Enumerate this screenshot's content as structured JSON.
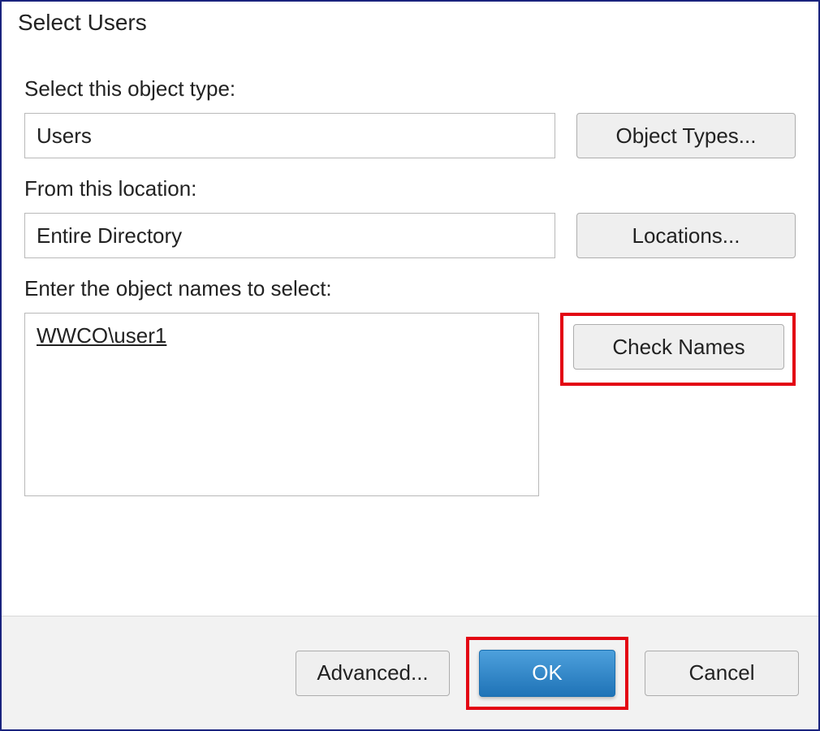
{
  "title": "Select Users",
  "labels": {
    "objectType": "Select this object type:",
    "location": "From this location:",
    "names": "Enter the object names to select:"
  },
  "fields": {
    "objectTypeValue": "Users",
    "locationValue": "Entire Directory",
    "namesValue": "WWCO\\user1"
  },
  "buttons": {
    "objectTypes": "Object Types...",
    "locations": "Locations...",
    "checkNames": "Check Names",
    "advanced": "Advanced...",
    "ok": "OK",
    "cancel": "Cancel"
  }
}
